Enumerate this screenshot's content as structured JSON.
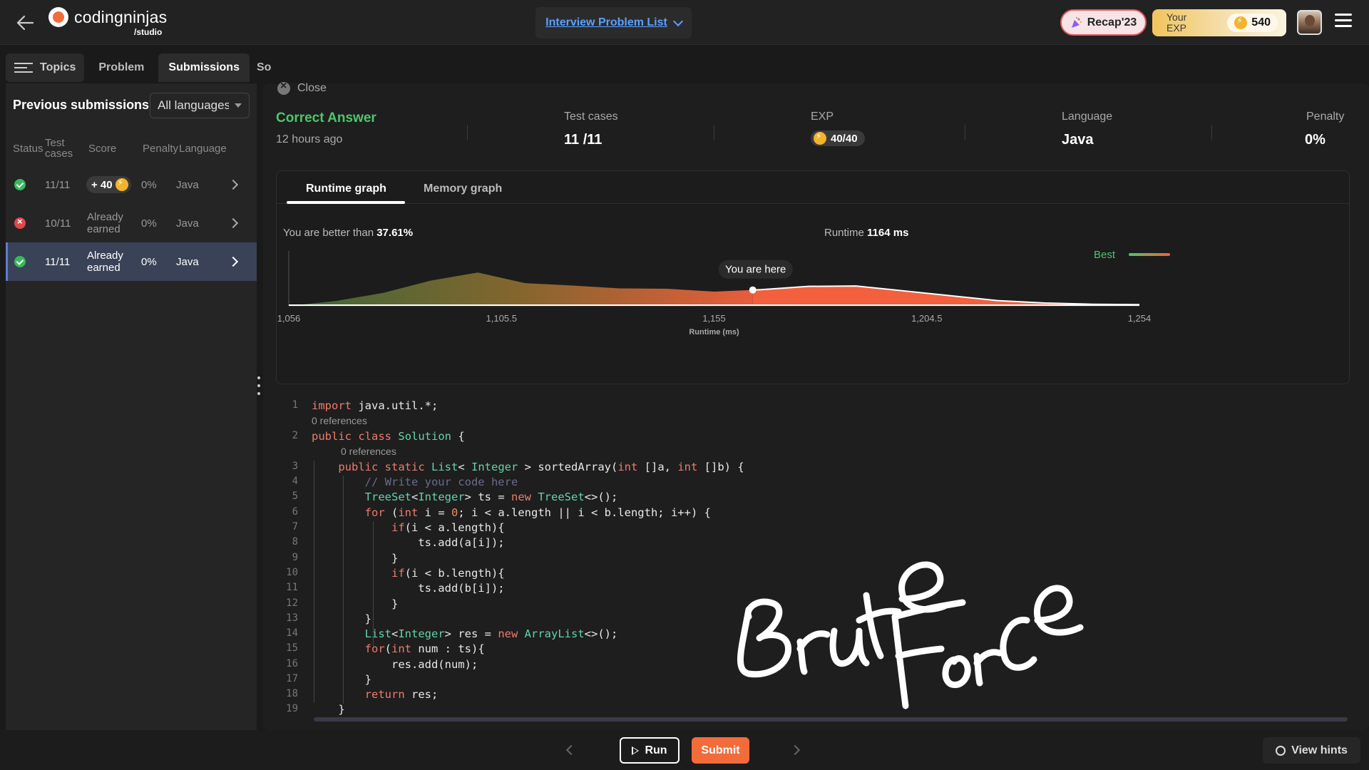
{
  "header": {
    "logo_name": "codingninjas",
    "logo_sub": "/studio",
    "problem_list_label": "Interview Problem List",
    "recap_label": "Recap'23",
    "exp_label": "Your EXP",
    "exp_value": "540"
  },
  "left_tabs": {
    "topics": "Topics",
    "problem": "Problem",
    "submissions": "Submissions",
    "clipped": "Solutions"
  },
  "submissions_panel": {
    "title": "Previous submissions",
    "language_filter": "All languages",
    "columns": {
      "status": "Status",
      "test_cases": "Test cases",
      "score": "Score",
      "penalty": "Penalty",
      "language": "Language"
    },
    "rows": [
      {
        "status": "accepted",
        "test_cases": "11/11",
        "score": "+ 40",
        "penalty": "0%",
        "language": "Java",
        "selected": false
      },
      {
        "status": "failed",
        "test_cases": "10/11",
        "score": "Already earned",
        "penalty": "0%",
        "language": "Java",
        "selected": false
      },
      {
        "status": "accepted",
        "test_cases": "11/11",
        "score": "Already earned",
        "penalty": "0%",
        "language": "Java",
        "selected": true
      }
    ]
  },
  "result": {
    "close_label": "Close",
    "verdict": "Correct Answer",
    "time_ago": "12 hours ago",
    "test_cases_label": "Test cases",
    "test_cases_value": "11 /11",
    "exp_label": "EXP",
    "exp_value": "40/40",
    "language_label": "Language",
    "language_value": "Java",
    "penalty_label": "Penalty",
    "penalty_value": "0%"
  },
  "graph": {
    "tabs": [
      "Runtime graph",
      "Memory graph"
    ],
    "active_tab": "Runtime graph",
    "better_than_prefix": "You are better than",
    "better_than_value": "37.61%",
    "runtime_prefix": "Runtime",
    "runtime_value": "1164 ms",
    "marker_label": "You are here",
    "legend_label": "Best",
    "colors": {
      "low": "#3f6b3a",
      "mid": "#8a6a2e",
      "high": "#f2603e",
      "legend_green": "#4cc66d"
    }
  },
  "chart_data": {
    "type": "area",
    "xlabel": "Runtime (ms)",
    "ylabel": "",
    "xlim": [
      1056,
      1254
    ],
    "x_ticks": [
      "1,056",
      "1,105.5",
      "1,155",
      "1,204.5",
      "1,254"
    ],
    "x": [
      1056,
      1067,
      1078,
      1089,
      1100,
      1111,
      1122,
      1133,
      1144,
      1155,
      1166,
      1177,
      1188,
      1199,
      1210,
      1221,
      1232,
      1243,
      1254
    ],
    "values": [
      0.0,
      0.12,
      0.32,
      0.62,
      0.82,
      0.56,
      0.5,
      0.43,
      0.42,
      0.35,
      0.4,
      0.48,
      0.49,
      0.37,
      0.25,
      0.13,
      0.07,
      0.04,
      0.03
    ],
    "marker_x": 1164,
    "legend": "Best"
  },
  "editor": {
    "references_label": "0 references",
    "lines": [
      "import java.util.*;",
      "public class Solution {",
      "    public static List< Integer > sortedArray(int []a, int []b) {",
      "        // Write your code here",
      "        TreeSet<Integer> ts = new TreeSet<>();",
      "        for (int i = 0; i < a.length || i < b.length; i++) {",
      "            if(i < a.length){",
      "                ts.add(a[i]);",
      "            }",
      "            if(i < b.length){",
      "                ts.add(b[i]);",
      "            }",
      "        }",
      "        List<Integer> res = new ArrayList<>();",
      "        for(int num : ts){",
      "            res.add(num);",
      "        }",
      "        return res;",
      "    }"
    ]
  },
  "annotation": {
    "handwritten_text": "Brute Force"
  },
  "footer": {
    "run_label": "Run",
    "submit_label": "Submit",
    "hints_label": "View hints"
  }
}
